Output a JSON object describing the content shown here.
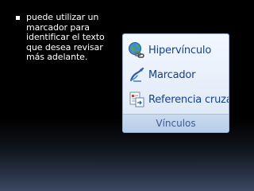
{
  "bullet": {
    "text": "puede utilizar un marcador para identificar el texto que desea revisar más adelante."
  },
  "ribbon_group": {
    "items": [
      {
        "label": "Hipervínculo",
        "icon": "hyperlink-globe-icon"
      },
      {
        "label": "Marcador",
        "icon": "bookmark-icon"
      },
      {
        "label": "Referencia cruzada",
        "icon": "cross-reference-icon"
      }
    ],
    "group_label": "Vínculos"
  },
  "colors": {
    "background": "#000000",
    "bullet_text": "#ffffff",
    "ribbon_text": "#15428b",
    "ribbon_background": "#e6eef9",
    "group_label_text": "#3b5b8f"
  }
}
